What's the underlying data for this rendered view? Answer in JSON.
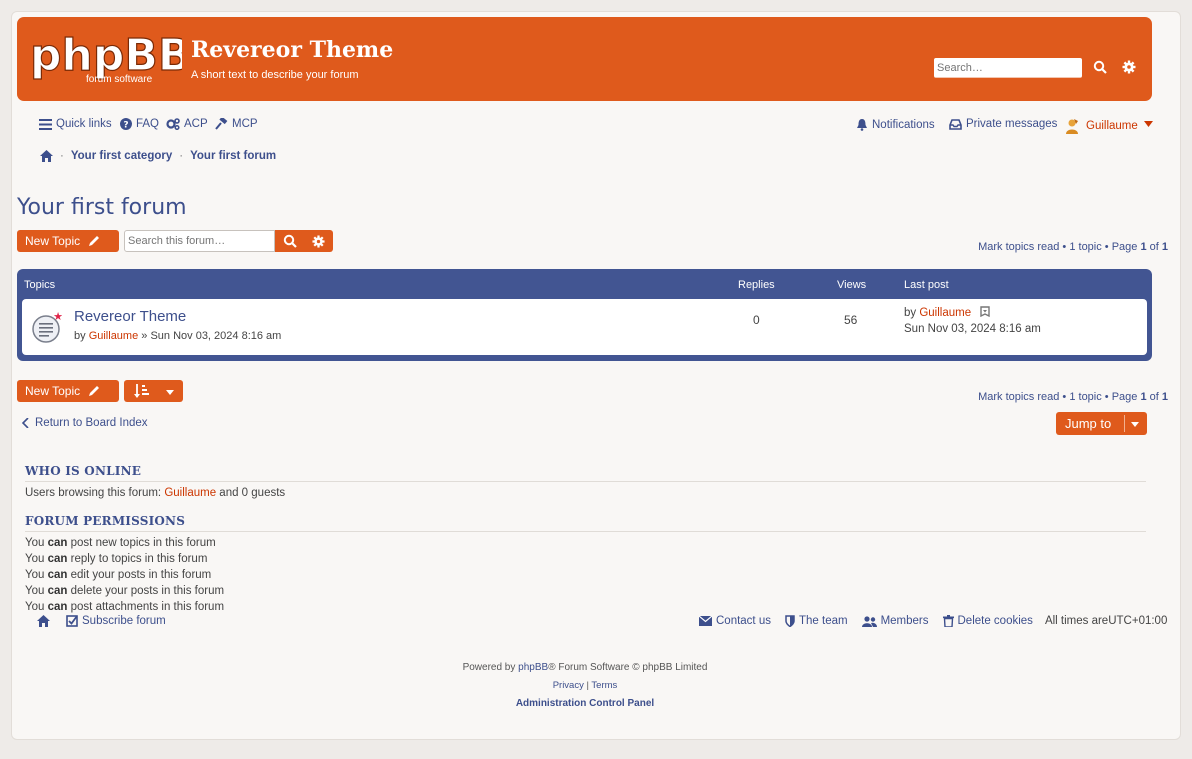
{
  "site": {
    "logo_main": "phpBB",
    "logo_tagline": "forum software",
    "title": "Revereor Theme",
    "description": "A short text to describe your forum",
    "search_placeholder": "Search…"
  },
  "navbar": {
    "quick_links": "Quick links",
    "faq": "FAQ",
    "acp": "ACP",
    "mcp": "MCP",
    "notifications": "Notifications",
    "private_messages": "Private messages",
    "username": "Guillaume"
  },
  "breadcrumb": {
    "items": [
      "Your first category",
      "Your first forum"
    ]
  },
  "forum": {
    "title": "Your first forum",
    "new_topic": "New Topic",
    "search_placeholder": "Search this forum…",
    "pagination": {
      "prefix": "Mark topics read • 1 topic • Page ",
      "current": "1",
      "of": " of ",
      "total": "1"
    }
  },
  "topics_table": {
    "headers": {
      "topics": "Topics",
      "replies": "Replies",
      "views": "Views",
      "last_post": "Last post"
    },
    "rows": [
      {
        "title": "Revereor Theme",
        "by": "by ",
        "author": "Guillaume",
        "sep": " » ",
        "date": "Sun Nov 03, 2024 8:16 am",
        "replies": "0",
        "views": "56",
        "last_by": "by ",
        "last_author": "Guillaume",
        "last_date": "Sun Nov 03, 2024 8:16 am"
      }
    ]
  },
  "actions": {
    "return_index": "Return to Board Index",
    "jump_to": "Jump to"
  },
  "who_is_online": {
    "heading": "WHO IS ONLINE",
    "prefix": "Users browsing this forum: ",
    "user": "Guillaume",
    "suffix": " and 0 guests"
  },
  "permissions": {
    "heading": "FORUM PERMISSIONS",
    "you": "You ",
    "can": "can",
    "lines": [
      " post new topics in this forum",
      " reply to topics in this forum",
      " edit your posts in this forum",
      " delete your posts in this forum",
      " post attachments in this forum"
    ]
  },
  "footer": {
    "subscribe": "Subscribe forum",
    "contact": "Contact us",
    "team": "The team",
    "members": "Members",
    "delete_cookies": "Delete cookies",
    "times_prefix": "All times are ",
    "timezone": "UTC+01:00",
    "powered_prefix": "Powered by ",
    "phpbb": "phpBB",
    "powered_suffix": "® Forum Software © phpBB Limited",
    "privacy": "Privacy",
    "pipe": " | ",
    "terms": "Terms",
    "acp_link": "Administration Control Panel"
  },
  "colors": {
    "brand": "#df5a1c",
    "link": "#3d4f8c",
    "table_header": "#425592",
    "username": "#cc3600"
  }
}
